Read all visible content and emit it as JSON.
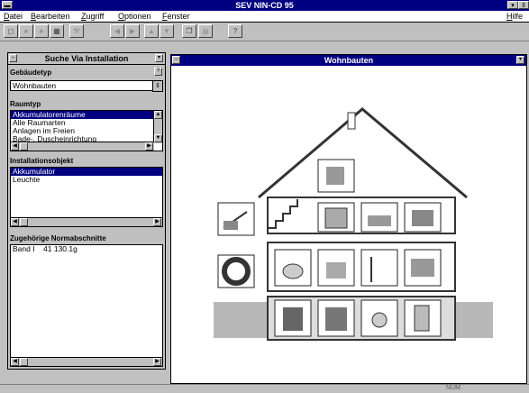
{
  "app": {
    "title": "SEV NIN-CD 95"
  },
  "menu": {
    "items": [
      "Datei",
      "Bearbeiten",
      "Zugriff",
      "Optionen",
      "Fenster"
    ],
    "help": "Hilfe"
  },
  "toolbar": {
    "icons": [
      "open-icon",
      "search-icon",
      "find-icon",
      "grid-icon",
      "tools-icon",
      "first-icon",
      "prev-icon",
      "up-icon",
      "down-icon",
      "copy-icon",
      "print-icon",
      "help-icon"
    ]
  },
  "search_pane": {
    "title": "Suche Via Installation",
    "building_label": "Gebäudetyp",
    "building_value": "Wohnbauten",
    "room_label": "Raumtyp",
    "rooms": [
      "Akkumulatorenräume",
      "Alle Raumarten",
      "Anlagen im Freien",
      "Bade-, Duscheinrichtung"
    ],
    "object_label": "Installationsobjekt",
    "objects": [
      "Akkumulator",
      "Leuchte"
    ],
    "norm_label": "Zugehörige Normabschnitte",
    "norms": [
      "Band I    41 130.1g"
    ]
  },
  "doc_window": {
    "title": "Wohnbauten"
  },
  "status": {
    "text": "NUM"
  }
}
